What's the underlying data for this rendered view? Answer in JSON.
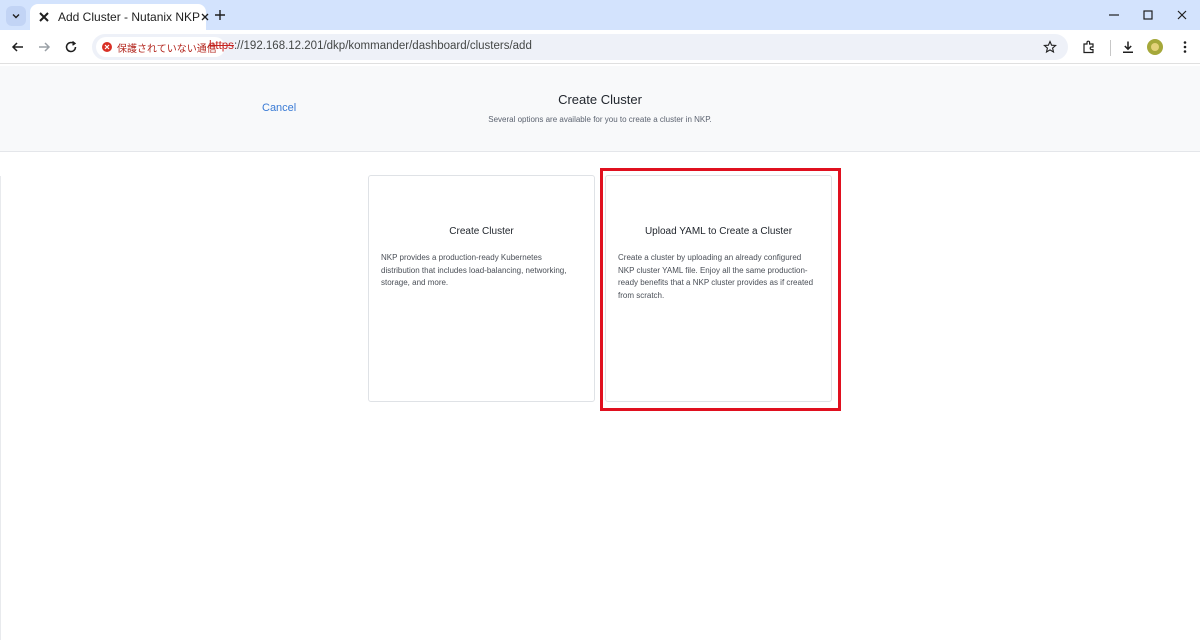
{
  "browser": {
    "tab": {
      "title": "Add Cluster - Nutanix NKP",
      "favicon": "nkp-x-icon"
    },
    "address_bar": {
      "security_chip": "保護されていない通信",
      "url_scheme": "https",
      "url_rest": "://192.168.12.201/dkp/kommander/dashboard/clusters/add"
    },
    "icons": [
      "back-icon",
      "forward-icon",
      "reload-icon",
      "star-icon",
      "extensions-icon",
      "download-icon",
      "profile-avatar",
      "menu-icon"
    ]
  },
  "header": {
    "cancel_label": "Cancel",
    "title": "Create Cluster",
    "subtitle": "Several options are available for you to create a cluster in NKP."
  },
  "cards": [
    {
      "title": "Create Cluster",
      "description": "NKP provides a production-ready Kubernetes distribution that includes load-balancing, networking, storage, and more."
    },
    {
      "title": "Upload YAML to Create a Cluster",
      "description": "Create a cluster by uploading an already configured NKP cluster YAML file. Enjoy all the same production-ready benefits that a NKP cluster provides as if created from scratch."
    }
  ],
  "colors": {
    "accent": "#3a7bd5",
    "highlight": "#e0101f",
    "tabbar": "#d3e3fd"
  }
}
